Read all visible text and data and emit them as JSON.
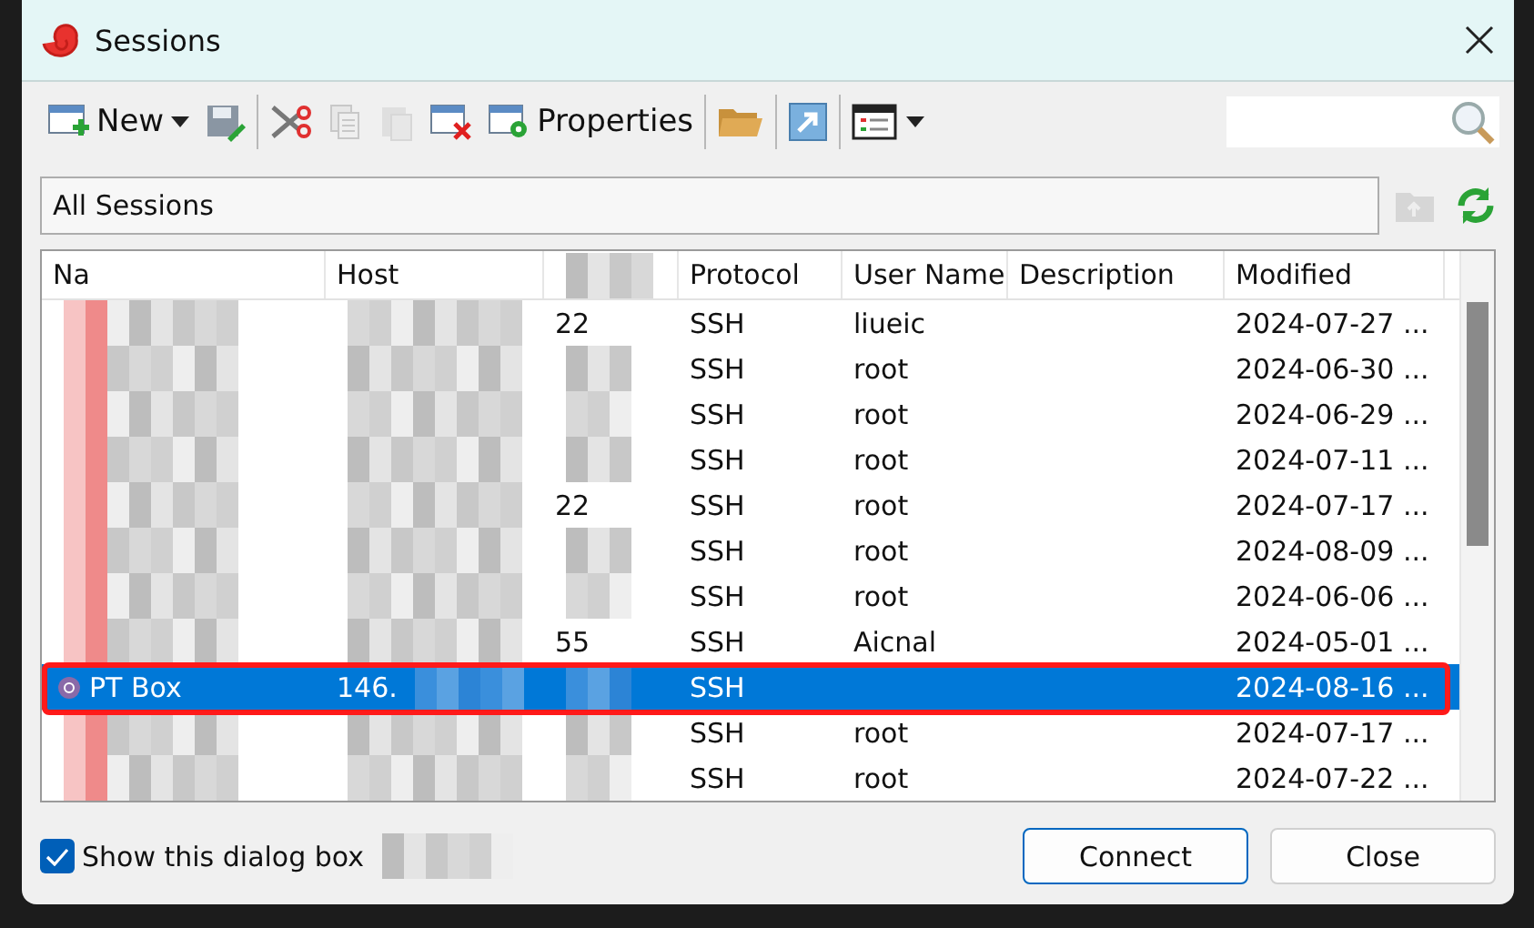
{
  "window": {
    "title": "Sessions"
  },
  "toolbar": {
    "groups": [
      [
        {
          "kind": "new",
          "label": "New",
          "dropdown": true,
          "disabled": false
        },
        {
          "kind": "save",
          "disabled": false
        }
      ],
      [
        {
          "kind": "cut",
          "disabled": false
        },
        {
          "kind": "copy",
          "disabled": true
        },
        {
          "kind": "paste",
          "disabled": true
        },
        {
          "kind": "delete",
          "disabled": false
        },
        {
          "kind": "properties",
          "label": "Properties",
          "disabled": false
        }
      ],
      [
        {
          "kind": "open",
          "disabled": false
        }
      ],
      [
        {
          "kind": "shortcut",
          "disabled": false
        }
      ],
      [
        {
          "kind": "view",
          "dropdown": true,
          "disabled": false
        }
      ]
    ]
  },
  "path": {
    "value": "All Sessions"
  },
  "table": {
    "columns": [
      "Na",
      "Host",
      "",
      "Protocol",
      "User Name",
      "Description",
      "Modified"
    ],
    "rows": [
      {
        "port": "22",
        "protocol": "SSH",
        "user": "liueic",
        "modified": "2024-07-27 ...",
        "selected": false
      },
      {
        "protocol": "SSH",
        "user": "root",
        "modified": "2024-06-30 ...",
        "selected": false
      },
      {
        "protocol": "SSH",
        "user": "root",
        "modified": "2024-06-29 ...",
        "selected": false
      },
      {
        "protocol": "SSH",
        "user": "root",
        "modified": "2024-07-11 ...",
        "selected": false
      },
      {
        "port": "22",
        "protocol": "SSH",
        "user": "root",
        "modified": "2024-07-17 ...",
        "selected": false
      },
      {
        "protocol": "SSH",
        "user": "root",
        "modified": "2024-08-09 ...",
        "selected": false
      },
      {
        "protocol": "SSH",
        "user": "root",
        "modified": "2024-06-06 ...",
        "selected": false
      },
      {
        "port": "55",
        "protocol": "SSH",
        "user": "Aicnal",
        "modified": "2024-05-01 ...",
        "selected": false
      },
      {
        "name": "PT Box",
        "host": "146.",
        "protocol": "SSH",
        "modified": "2024-08-16 ...",
        "selected": true
      },
      {
        "protocol": "SSH",
        "user": "root",
        "modified": "2024-07-17 ...",
        "selected": false
      },
      {
        "protocol": "SSH",
        "user": "root",
        "modified": "2024-07-22 ...",
        "selected": false
      }
    ]
  },
  "startup_checkbox": {
    "label": "Show this dialog box",
    "checked": true
  },
  "buttons": [
    {
      "label": "Connect",
      "default": true
    },
    {
      "label": "Close",
      "default": false
    }
  ]
}
